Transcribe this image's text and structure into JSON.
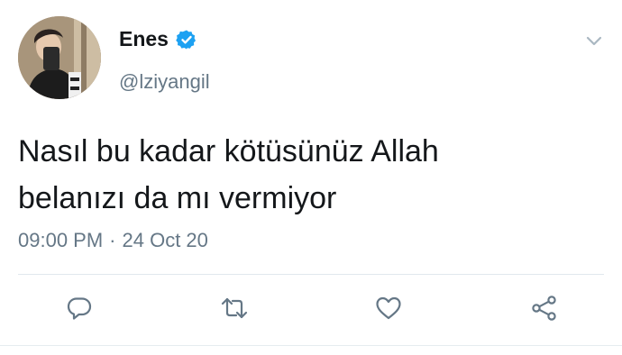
{
  "user": {
    "display_name": "Enes",
    "handle": "@lziyangil"
  },
  "tweet": {
    "text_line1": "Nasıl bu kadar kötüsünüz Allah",
    "text_line2": "belanızı da mı vermiyor",
    "time": "09:00 PM",
    "separator": "·",
    "date": "24 Oct 20"
  },
  "icons": {
    "verified": "verified-badge-icon",
    "more": "chevron-down-icon",
    "reply": "reply-icon",
    "retweet": "retweet-icon",
    "like": "heart-icon",
    "share": "share-icon"
  },
  "colors": {
    "verified_blue": "#1da1f2",
    "text_primary": "#14171a",
    "text_secondary": "#657786",
    "icon_gray": "#657786"
  }
}
